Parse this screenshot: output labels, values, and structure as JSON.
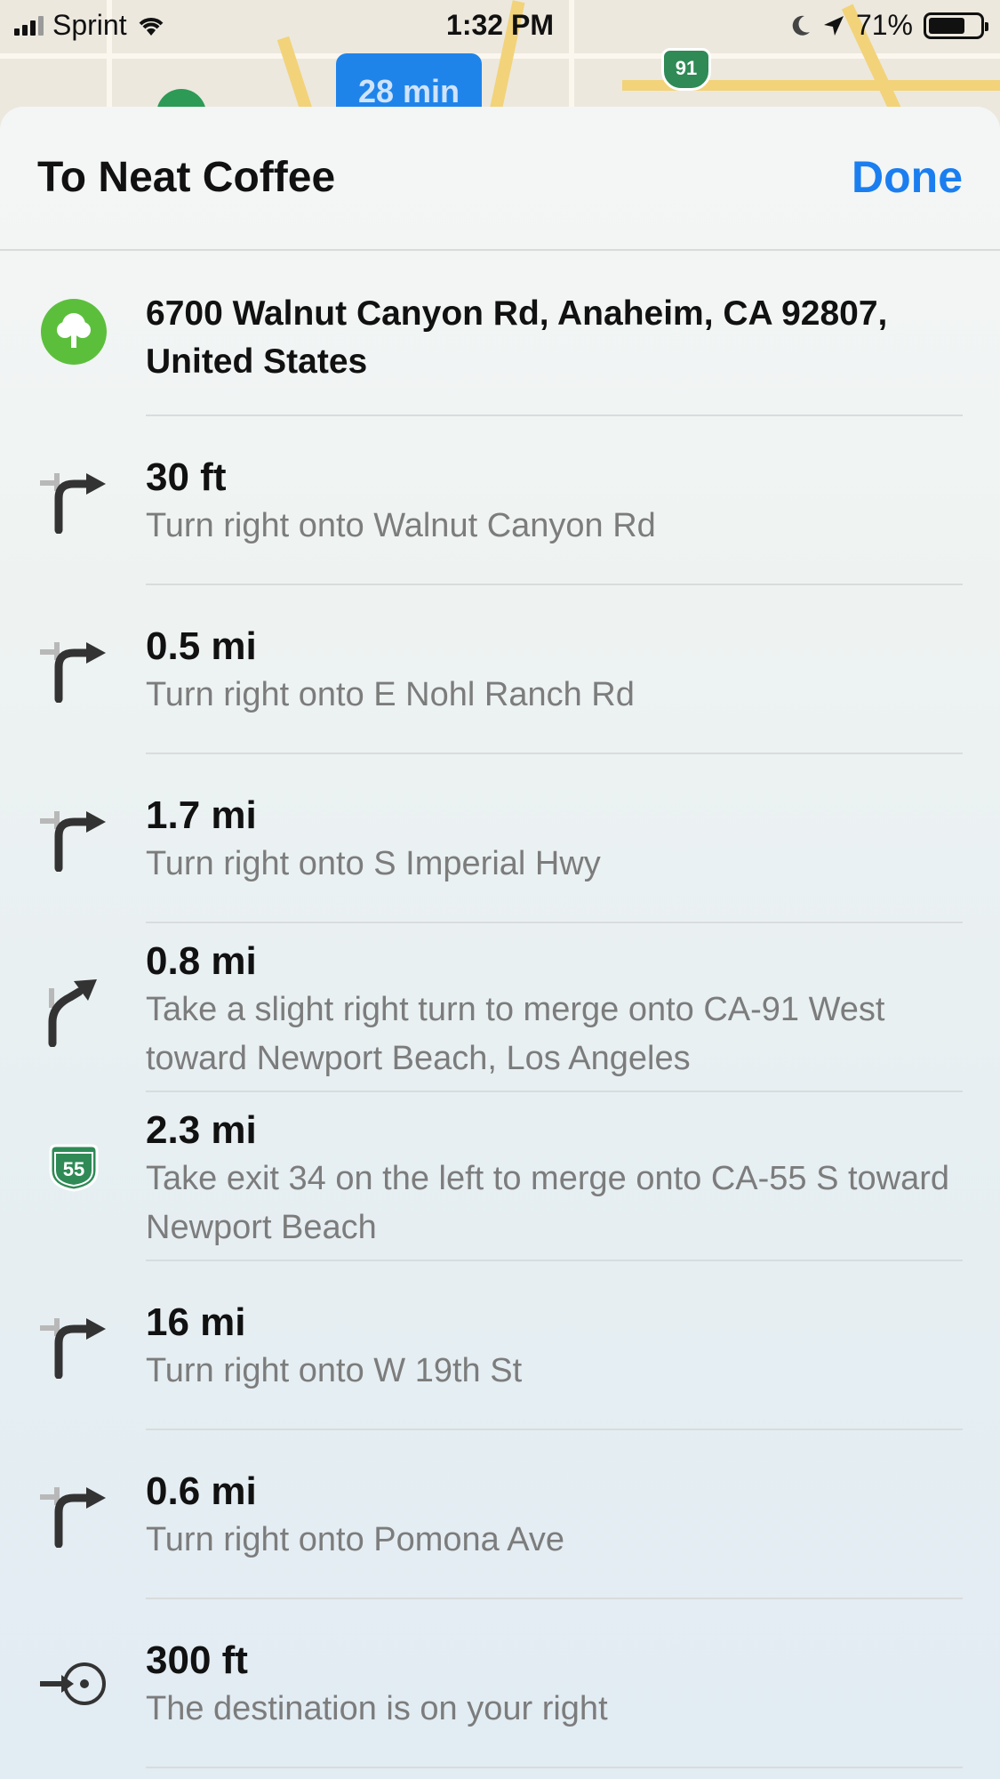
{
  "status_bar": {
    "carrier": "Sprint",
    "time": "1:32 PM",
    "battery_percent": "71%",
    "battery_level": 0.71
  },
  "map": {
    "eta_label": "28 min",
    "route_shield": "91"
  },
  "sheet": {
    "title": "To Neat Coffee",
    "done_label": "Done"
  },
  "start": {
    "icon": "tree-icon",
    "address": "6700 Walnut Canyon Rd, Anaheim, CA  92807, United States"
  },
  "steps": [
    {
      "icon": "turn-right-icon",
      "distance": "30 ft",
      "instruction": "Turn right onto Walnut Canyon Rd"
    },
    {
      "icon": "turn-right-icon",
      "distance": "0.5 mi",
      "instruction": "Turn right onto E Nohl Ranch Rd"
    },
    {
      "icon": "turn-right-icon",
      "distance": "1.7 mi",
      "instruction": "Turn right onto S Imperial Hwy"
    },
    {
      "icon": "slight-right-icon",
      "distance": "0.8 mi",
      "instruction": "Take a slight right turn to merge onto CA-91 West toward Newport Beach, Los Angeles"
    },
    {
      "icon": "highway-shield-icon",
      "shield_number": "55",
      "distance": "2.3 mi",
      "instruction": "Take exit 34 on the left to merge onto CA-55 S toward Newport Beach"
    },
    {
      "icon": "turn-right-icon",
      "distance": "16 mi",
      "instruction": "Turn right onto W 19th St"
    },
    {
      "icon": "turn-right-icon",
      "distance": "0.6 mi",
      "instruction": "Turn right onto Pomona Ave"
    },
    {
      "icon": "arrive-icon",
      "distance": "300 ft",
      "instruction": "The destination is on your right"
    }
  ],
  "colors": {
    "accent": "#1a7ef0",
    "start_pin": "#5cbf3c",
    "shield": "#2f8a56"
  }
}
